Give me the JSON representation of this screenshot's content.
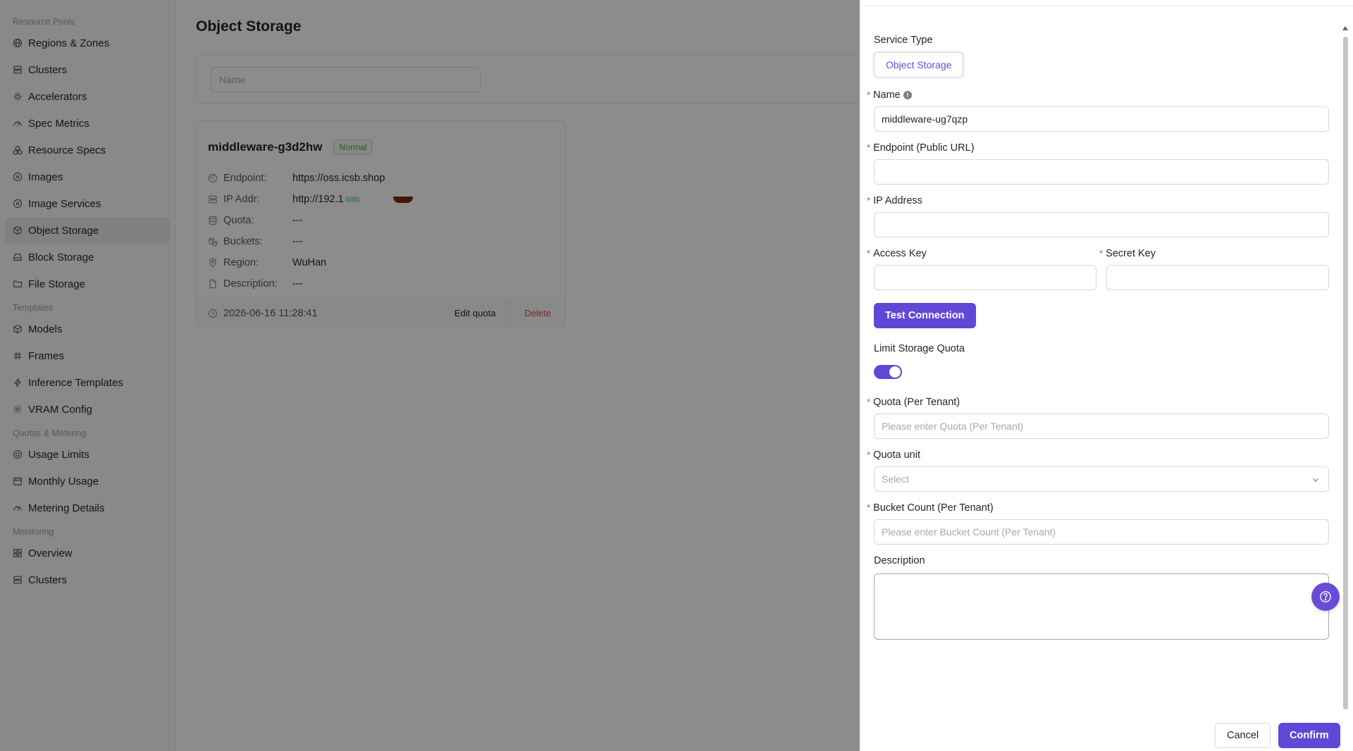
{
  "sidebar": {
    "sections": [
      {
        "title": "Resource Pools",
        "items": [
          {
            "label": "Regions & Zones",
            "icon": "globe-icon"
          },
          {
            "label": "Clusters",
            "icon": "server-icon"
          },
          {
            "label": "Accelerators",
            "icon": "chip-icon"
          },
          {
            "label": "Spec Metrics",
            "icon": "gauge-icon"
          },
          {
            "label": "Resource Specs",
            "icon": "cubes-icon"
          },
          {
            "label": "Images",
            "icon": "disc-icon"
          },
          {
            "label": "Image Services",
            "icon": "disc-icon"
          },
          {
            "label": "Object Storage",
            "icon": "package-icon",
            "active": true
          },
          {
            "label": "Block Storage",
            "icon": "drive-icon"
          },
          {
            "label": "File Storage",
            "icon": "folder-icon"
          }
        ]
      },
      {
        "title": "Templates",
        "items": [
          {
            "label": "Models",
            "icon": "cube-icon"
          },
          {
            "label": "Frames",
            "icon": "hash-icon"
          },
          {
            "label": "Inference Templates",
            "icon": "bolt-icon"
          },
          {
            "label": "VRAM Config",
            "icon": "gear-icon"
          }
        ]
      },
      {
        "title": "Quotas & Metering",
        "items": [
          {
            "label": "Usage Limits",
            "icon": "target-icon"
          },
          {
            "label": "Monthly Usage",
            "icon": "calendar-icon"
          },
          {
            "label": "Metering Details",
            "icon": "gauge-icon"
          }
        ]
      },
      {
        "title": "Monitoring",
        "items": [
          {
            "label": "Overview",
            "icon": "grid-icon"
          },
          {
            "label": "Clusters",
            "icon": "server-icon"
          }
        ]
      }
    ]
  },
  "main": {
    "title": "Object Storage",
    "filter": {
      "name_placeholder": "Name"
    },
    "card": {
      "name": "middleware-g3d2hw",
      "status": "Normal",
      "rows": [
        {
          "label": "Endpoint:",
          "value": "https://oss.icsb.shop",
          "icon": "globe-icon"
        },
        {
          "label": "IP Addr:",
          "value": "http://192.1",
          "icon": "server-icon",
          "redacted": true
        },
        {
          "label": "Quota:",
          "value": "---",
          "icon": "database-icon"
        },
        {
          "label": "Buckets:",
          "value": "---",
          "icon": "buckets-icon"
        },
        {
          "label": "Region:",
          "value": "WuHan",
          "icon": "pin-icon"
        },
        {
          "label": "Description:",
          "value": "---",
          "icon": "file-icon"
        }
      ],
      "created": "2026-06-16 11:28:41",
      "edit_label": "Edit quota",
      "delete_label": "Delete"
    }
  },
  "drawer": {
    "service_type_label": "Service Type",
    "service_type_value": "Object Storage",
    "name_label": "Name",
    "name_value": "middleware-ug7qzp",
    "endpoint_label": "Endpoint (Public URL)",
    "endpoint_value": "",
    "ip_label": "IP Address",
    "ip_value": "",
    "access_key_label": "Access Key",
    "secret_key_label": "Secret Key",
    "test_connection_label": "Test Connection",
    "limit_quota_label": "Limit Storage Quota",
    "limit_quota_on": true,
    "quota_label": "Quota (Per Tenant)",
    "quota_placeholder": "Please enter Quota (Per Tenant)",
    "quota_unit_label": "Quota unit",
    "quota_unit_placeholder": "Select",
    "bucket_count_label": "Bucket Count (Per Tenant)",
    "bucket_count_placeholder": "Please enter Bucket Count (Per Tenant)",
    "description_label": "Description",
    "cancel_label": "Cancel",
    "confirm_label": "Confirm"
  },
  "colors": {
    "accent": "#6147d6",
    "danger": "#e04343",
    "success": "#52a44a",
    "overlay": "rgba(0,0,0,0.45)"
  }
}
